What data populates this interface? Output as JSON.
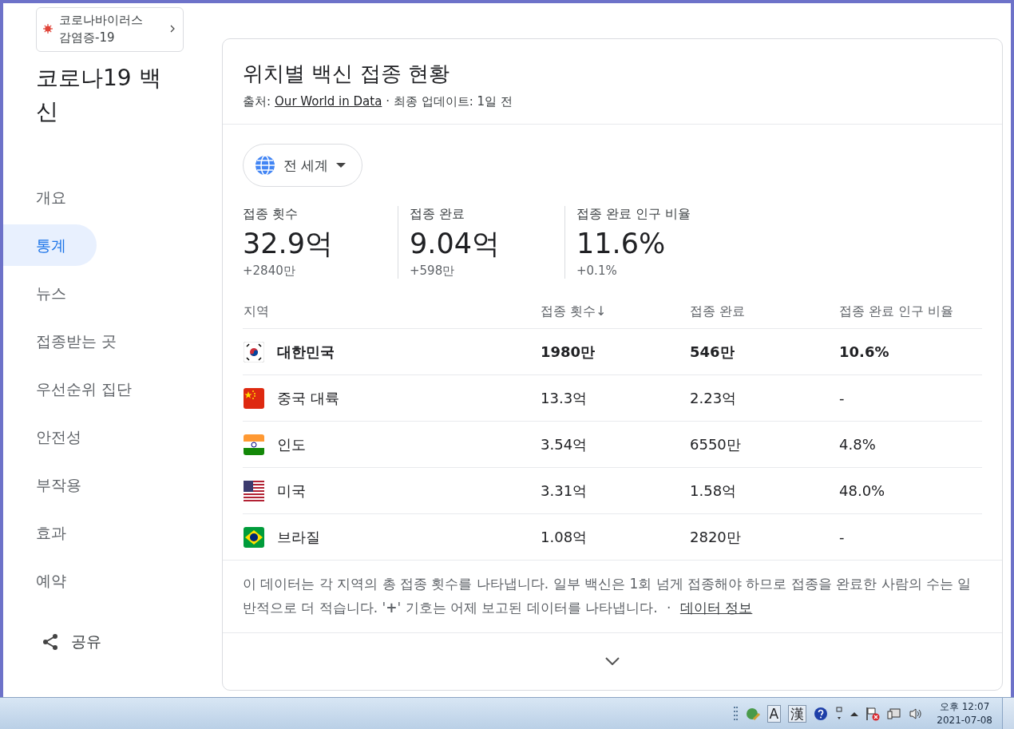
{
  "topic_chip": {
    "label": "코로나바이러스 감염증-19"
  },
  "page_title": "코로나19 백신",
  "nav": [
    {
      "label": "개요",
      "selected": false
    },
    {
      "label": "통계",
      "selected": true
    },
    {
      "label": "뉴스",
      "selected": false
    },
    {
      "label": "접종받는 곳",
      "selected": false
    },
    {
      "label": "우선순위 집단",
      "selected": false
    },
    {
      "label": "안전성",
      "selected": false
    },
    {
      "label": "부작용",
      "selected": false
    },
    {
      "label": "효과",
      "selected": false
    },
    {
      "label": "예약",
      "selected": false
    }
  ],
  "share": {
    "label": "공유"
  },
  "card": {
    "title": "위치별 백신 접종 현황",
    "source_label": "출처:",
    "source_link": "Our World in Data",
    "updated": "· 최종 업데이트: 1일 전",
    "region_dropdown": "전 세계",
    "stats": [
      {
        "label": "접종 횟수",
        "value": "32.9억",
        "change": "+2840만"
      },
      {
        "label": "접종 완료",
        "value": "9.04억",
        "change": "+598만"
      },
      {
        "label": "접종 완료 인구 비율",
        "value": "11.6%",
        "change": "+0.1%"
      }
    ],
    "table": {
      "columns": [
        "지역",
        "접종 횟수↓",
        "접종 완료",
        "접종 완료 인구 비율"
      ],
      "rows": [
        {
          "kind": "kr",
          "highlighted": true,
          "cells": [
            "대한민국",
            "1980만",
            "546만",
            "10.6%"
          ]
        },
        {
          "kind": "cn",
          "highlighted": false,
          "cells": [
            "중국 대륙",
            "13.3억",
            "2.23억",
            "-"
          ]
        },
        {
          "kind": "in",
          "highlighted": false,
          "cells": [
            "인도",
            "3.54억",
            "6550만",
            "4.8%"
          ]
        },
        {
          "kind": "us",
          "highlighted": false,
          "cells": [
            "미국",
            "3.31억",
            "1.58억",
            "48.0%"
          ]
        },
        {
          "kind": "br",
          "highlighted": false,
          "cells": [
            "브라질",
            "1.08억",
            "2820만",
            "-"
          ]
        }
      ]
    },
    "note": "이 데이터는 각 지역의 총 접종 횟수를 나타냅니다. 일부 백신은 1회 넘게 접종해야 하므로 접종을 완료한 사람의 수는 일반적으로 더 적습니다. '**+**' 기호는 어제 보고된 데이터를 나타냅니다.",
    "note_sep": "·",
    "note_link": "데이터 정보"
  },
  "taskbar": {
    "ime_keys": [
      "A",
      "漢"
    ],
    "time": "오후 12:07",
    "date": "2021-07-08"
  }
}
